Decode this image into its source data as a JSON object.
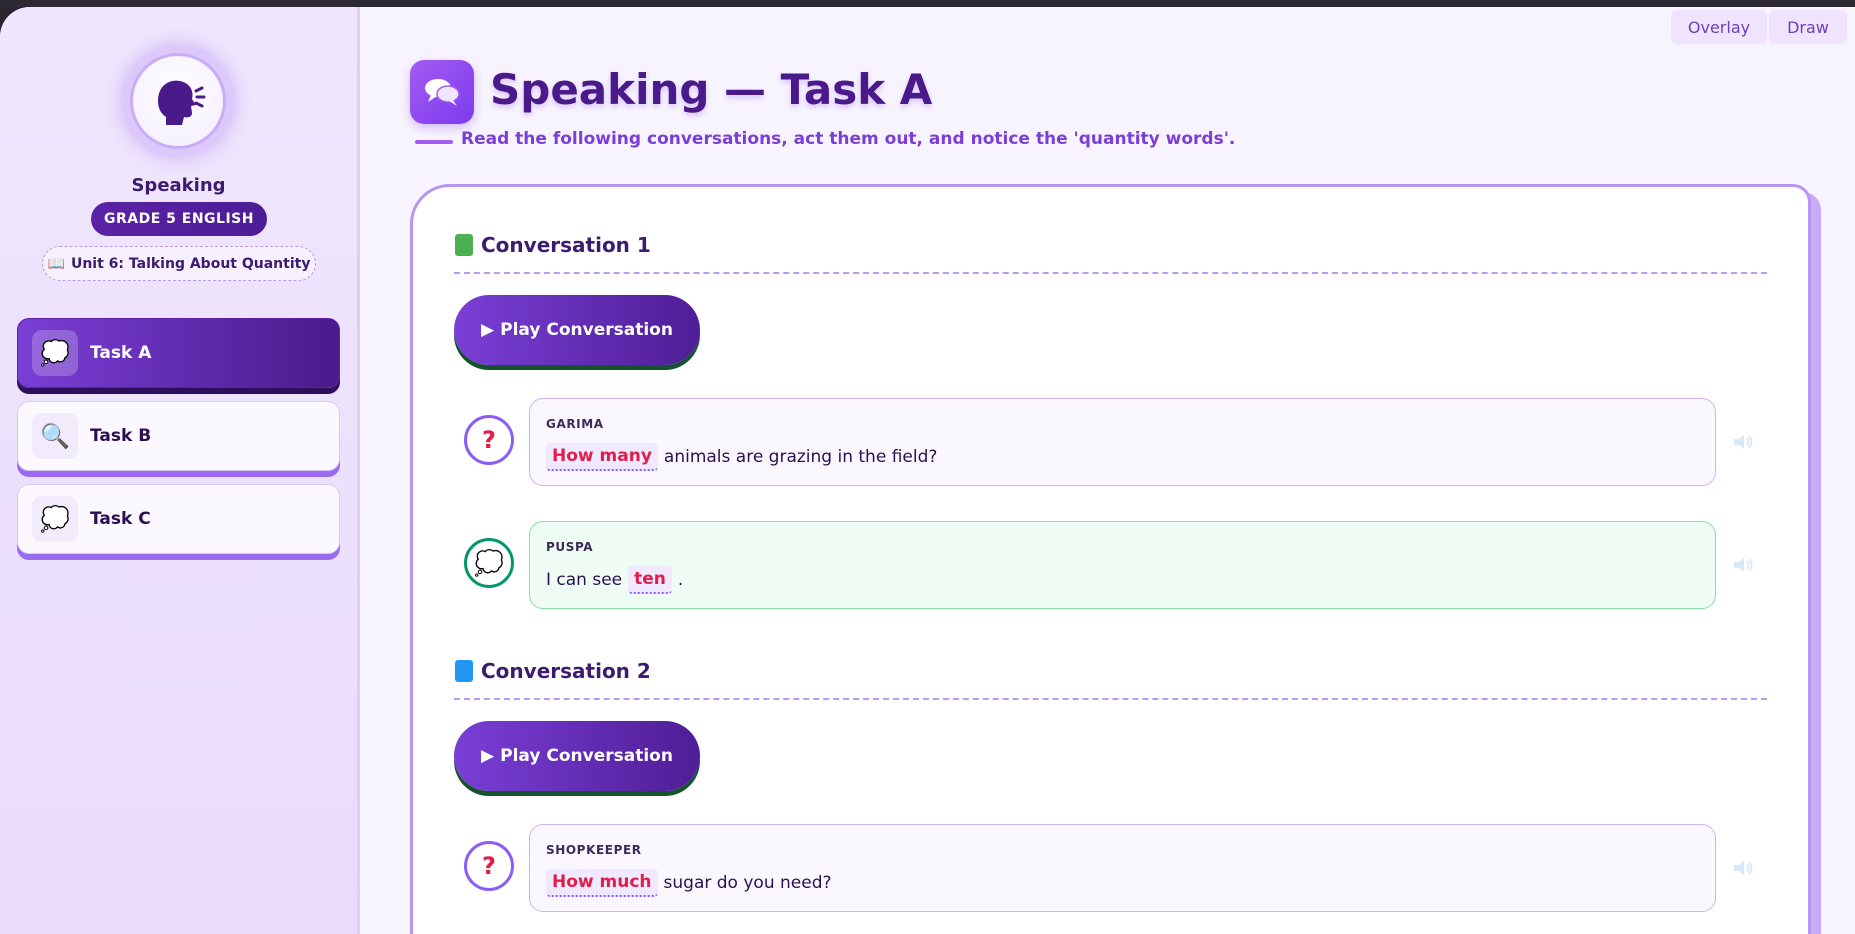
{
  "top_actions": {
    "overlay": "Overlay",
    "draw": "Draw"
  },
  "sidebar": {
    "title": "Speaking",
    "grade": "GRADE 5 ENGLISH",
    "unit": "Unit 6: Talking About Quantity",
    "unit_icon": "📖",
    "tasks": [
      {
        "label": "Task A",
        "icon": "💭",
        "active": true
      },
      {
        "label": "Task B",
        "icon": "🔍",
        "active": false
      },
      {
        "label": "Task C",
        "icon": "💭",
        "active": false
      }
    ]
  },
  "header": {
    "title": "Speaking — Task A",
    "subtitle": "Read the following conversations, act them out, and notice the 'quantity words'."
  },
  "conversations": [
    {
      "title": "Conversation 1",
      "book_color": "#4caf50",
      "play_label": "Play Conversation",
      "lines": [
        {
          "speaker": "GARIMA",
          "type": "question",
          "badge": "?",
          "highlight": "How many",
          "after": "animals are grazing in the field?"
        },
        {
          "speaker": "PUSPA",
          "type": "answer",
          "badge": "💭",
          "before": "I can see",
          "highlight": "ten",
          "after": "."
        }
      ]
    },
    {
      "title": "Conversation 2",
      "book_color": "#2196f3",
      "play_label": "Play Conversation",
      "lines": [
        {
          "speaker": "SHOPKEEPER",
          "type": "question",
          "badge": "?",
          "highlight": "How much",
          "after": "sugar do you need?"
        }
      ]
    }
  ],
  "icons": {
    "play": "▶",
    "volume": "volume-icon"
  }
}
